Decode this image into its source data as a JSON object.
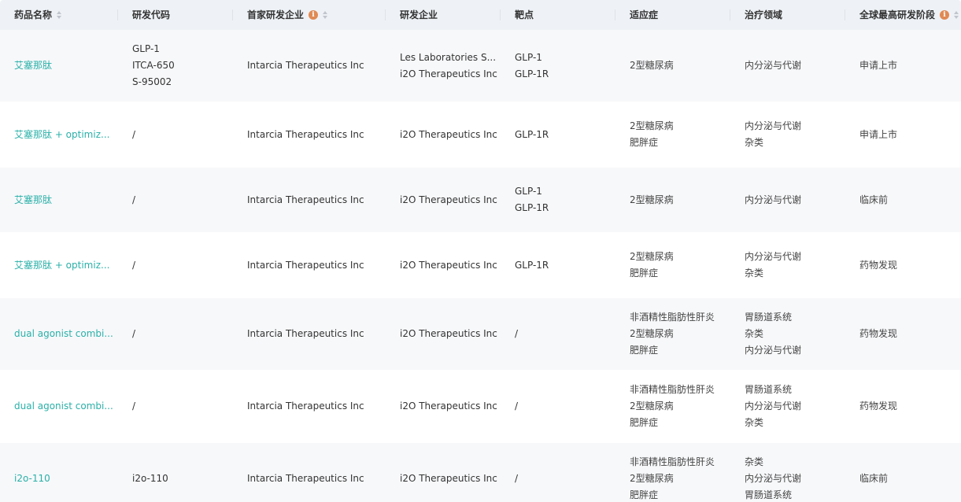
{
  "header": {
    "drug_name": "药品名称",
    "code": "研发代码",
    "first_company": "首家研发企业",
    "companies": "研发企业",
    "target": "靶点",
    "indication": "适应症",
    "therapy_area": "治疗领域",
    "highest_stage": "全球最高研发阶段",
    "info_glyph": "i"
  },
  "rows": [
    {
      "drug": "艾塞那肽",
      "codes": [
        "GLP-1",
        "ITCA-650",
        "S-95002"
      ],
      "first_company": "Intarcia Therapeutics Inc",
      "companies": [
        "Les Laboratories S...",
        "i2O Therapeutics Inc"
      ],
      "targets": [
        "GLP-1",
        "GLP-1R"
      ],
      "indications": [
        "2型糖尿病"
      ],
      "areas": [
        "内分泌与代谢"
      ],
      "stage": "申请上市",
      "height": 92
    },
    {
      "drug": "艾塞那肽 + optimiz...",
      "codes": [
        "/"
      ],
      "first_company": "Intarcia Therapeutics Inc",
      "companies": [
        "i2O Therapeutics Inc"
      ],
      "targets": [
        "GLP-1R"
      ],
      "indications": [
        "2型糖尿病",
        "肥胖症"
      ],
      "areas": [
        "内分泌与代谢",
        "杂类"
      ],
      "stage": "申请上市",
      "height": 83
    },
    {
      "drug": "艾塞那肽",
      "codes": [
        "/"
      ],
      "first_company": "Intarcia Therapeutics Inc",
      "companies": [
        "i2O Therapeutics Inc"
      ],
      "targets": [
        "GLP-1",
        "GLP-1R"
      ],
      "indications": [
        "2型糖尿病"
      ],
      "areas": [
        "内分泌与代谢"
      ],
      "stage": "临床前",
      "height": 83
    },
    {
      "drug": "艾塞那肽 + optimiz...",
      "codes": [
        "/"
      ],
      "first_company": "Intarcia Therapeutics Inc",
      "companies": [
        "i2O Therapeutics Inc"
      ],
      "targets": [
        "GLP-1R"
      ],
      "indications": [
        "2型糖尿病",
        "肥胖症"
      ],
      "areas": [
        "内分泌与代谢",
        "杂类"
      ],
      "stage": "药物发现",
      "height": 83
    },
    {
      "drug": "dual agonist combi...",
      "codes": [
        "/"
      ],
      "first_company": "Intarcia Therapeutics Inc",
      "companies": [
        "i2O Therapeutics Inc"
      ],
      "targets": [
        "/"
      ],
      "indications": [
        "非酒精性脂肪性肝炎",
        "2型糖尿病",
        "肥胖症"
      ],
      "areas": [
        "胃肠道系统",
        "杂类",
        "内分泌与代谢"
      ],
      "stage": "药物发现",
      "height": 92
    },
    {
      "drug": "dual agonist combi...",
      "codes": [
        "/"
      ],
      "first_company": "Intarcia Therapeutics Inc",
      "companies": [
        "i2O Therapeutics Inc"
      ],
      "targets": [
        "/"
      ],
      "indications": [
        "非酒精性脂肪性肝炎",
        "2型糖尿病",
        "肥胖症"
      ],
      "areas": [
        "胃肠道系统",
        "内分泌与代谢",
        "杂类"
      ],
      "stage": "药物发现",
      "height": 92
    },
    {
      "drug": "i2o-110",
      "codes": [
        "i2o-110"
      ],
      "first_company": "Intarcia Therapeutics Inc",
      "companies": [
        "i2O Therapeutics Inc"
      ],
      "targets": [
        "/"
      ],
      "indications": [
        "非酒精性脂肪性肝炎",
        "2型糖尿病",
        "肥胖症"
      ],
      "areas": [
        "杂类",
        "内分泌与代谢",
        "胃肠道系统"
      ],
      "stage": "临床前",
      "height": 92
    }
  ],
  "colors": {
    "link": "#2ab0a8",
    "header_bg": "#eef2f6",
    "stripe_bg": "#f7f8fa",
    "info_icon": "#e08a54"
  }
}
